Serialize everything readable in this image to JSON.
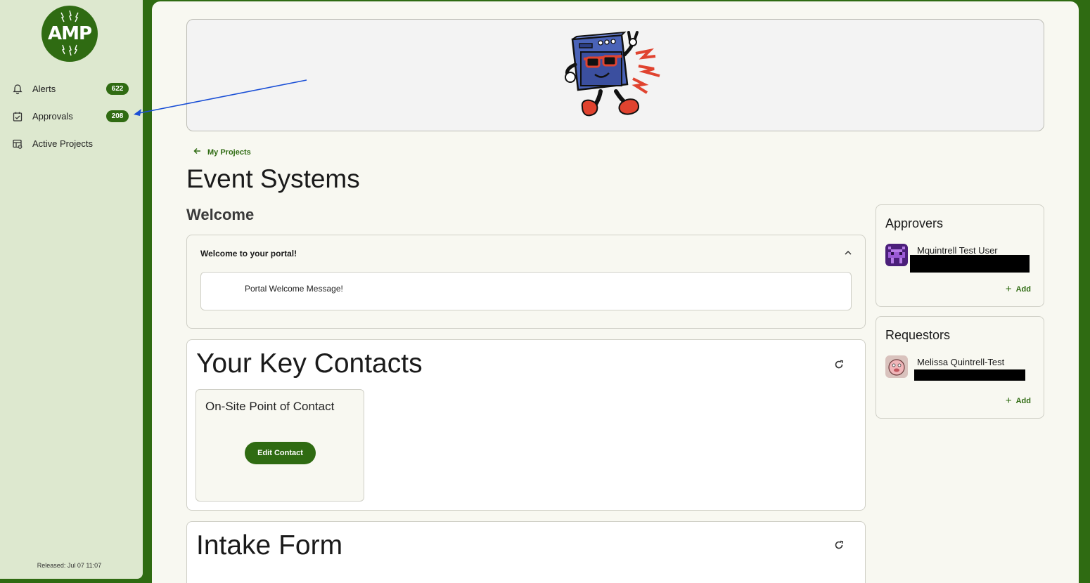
{
  "sidebar": {
    "logo_text": "AMP",
    "items": [
      {
        "label": "Alerts",
        "badge": "622",
        "icon": "bell-icon"
      },
      {
        "label": "Approvals",
        "badge": "208",
        "icon": "checklist-icon"
      },
      {
        "label": "Active Projects",
        "icon": "projects-eye-icon"
      }
    ],
    "released": "Released: Jul 07 11:07"
  },
  "main": {
    "back_link": "My Projects",
    "page_title": "Event Systems",
    "section_title": "Welcome",
    "welcome_card": {
      "header": "Welcome to your portal!",
      "message": "Portal Welcome Message!"
    },
    "contacts": {
      "title": "Your Key Contacts",
      "tile_title": "On-Site Point of Contact",
      "edit_button": "Edit Contact"
    },
    "intake": {
      "title": "Intake Form"
    },
    "approvers": {
      "title": "Approvers",
      "person_name": "Mquintrell Test User",
      "add_label": "Add"
    },
    "requestors": {
      "title": "Requestors",
      "person_name": "Melissa Quintrell-Test",
      "add_label": "Add"
    }
  },
  "colors": {
    "brand_green": "#2f6b12",
    "sidebar_bg": "#dde8cf",
    "panel_bg": "#f8f8f1",
    "annotation_arrow": "#1a4fd6"
  }
}
